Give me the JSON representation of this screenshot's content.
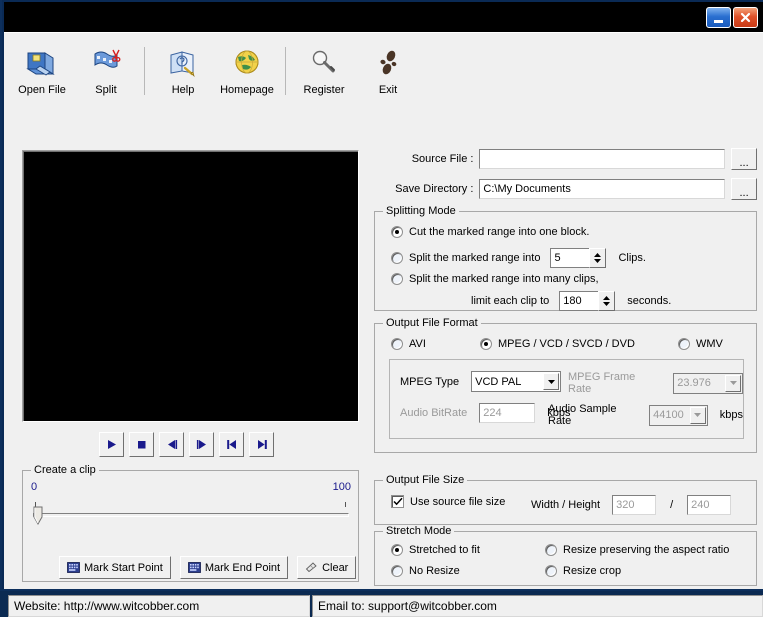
{
  "window": {
    "minimize_label": "Minimize",
    "close_label": "Close"
  },
  "toolbar": {
    "items": [
      {
        "label": "Open File",
        "icon": "open-folder-icon"
      },
      {
        "label": "Split",
        "icon": "film-scissors-icon"
      },
      {
        "label": "Help",
        "icon": "help-book-icon"
      },
      {
        "label": "Homepage",
        "icon": "globe-icon"
      },
      {
        "label": "Register",
        "icon": "key-icon"
      },
      {
        "label": "Exit",
        "icon": "footprints-icon"
      }
    ]
  },
  "transport": {
    "play": "Play",
    "stop": "Stop",
    "step_back": "Step Back",
    "step_forward": "Step Forward",
    "go_start": "Go To Start",
    "go_end": "Go To End"
  },
  "clip": {
    "group_title": "Create a clip",
    "slider_min": "0",
    "slider_max": "100",
    "mark_start_label": "Mark Start Point",
    "mark_end_label": "Mark End Point",
    "clear_label": "Clear"
  },
  "source": {
    "label": "Source File :",
    "value": "",
    "placeholder": "",
    "browse_label": "..."
  },
  "save_dir": {
    "label": "Save Directory :",
    "value": "C:\\My Documents",
    "browse_label": "..."
  },
  "splitting_mode": {
    "group_title": "Splitting Mode",
    "option1": "Cut the marked range into one block.",
    "option2_pre": "Split the marked range into",
    "option2_clips_value": "5",
    "option2_post": "Clips.",
    "option3": "Split the marked range into many clips,",
    "option3_pre": "limit each clip to",
    "option3_value": "180",
    "option3_post": "seconds.",
    "selected": 0
  },
  "output_format": {
    "group_title": "Output File Format",
    "avi": "AVI",
    "mpeg": "MPEG / VCD / SVCD / DVD",
    "wmv": "WMV",
    "selected": "mpeg",
    "mpeg_type_label": "MPEG Type",
    "mpeg_type_value": "VCD PAL",
    "frame_rate_label": "MPEG Frame Rate",
    "frame_rate_value": "23.976",
    "audio_bitrate_label": "Audio BitRate",
    "audio_bitrate_value": "224",
    "audio_bitrate_unit": "kbps",
    "audio_sample_label": "Audio Sample Rate",
    "audio_sample_value": "44100",
    "audio_sample_unit": "kbps"
  },
  "output_size": {
    "group_title": "Output File Size",
    "use_source_label": "Use source file size",
    "use_source_checked": true,
    "wh_label": "Width / Height",
    "width_value": "320",
    "separator": "/",
    "height_value": "240"
  },
  "stretch_mode": {
    "group_title": "Stretch Mode",
    "stretched": "Stretched to fit",
    "no_resize": "No Resize",
    "preserve": "Resize preserving the aspect ratio",
    "crop": "Resize crop",
    "selected": "stretched"
  },
  "status": {
    "website": "Website: http://www.witcobber.com",
    "email": "Email to: support@witcobber.com"
  },
  "colors": {
    "accent_blue": "#1a1a8c",
    "face": "#f0f0f0",
    "title_bg": "#000000",
    "frame": "#0d2f5c",
    "disabled_text": "#9a9a9a"
  }
}
